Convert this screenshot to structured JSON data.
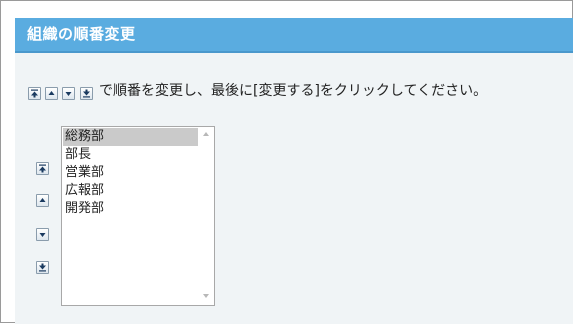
{
  "header": {
    "title": "組織の順番変更"
  },
  "instructions": {
    "text": "で順番を変更し、最後に[変更する]をクリックしてください。"
  },
  "order_buttons": {
    "top_icon": "move-to-top-icon",
    "up_icon": "move-up-icon",
    "down_icon": "move-down-icon",
    "bottom_icon": "move-to-bottom-icon"
  },
  "org_list": {
    "items": [
      {
        "label": "総務部",
        "selected": true
      },
      {
        "label": "部長",
        "selected": false
      },
      {
        "label": "営業部",
        "selected": false
      },
      {
        "label": "広報部",
        "selected": false
      },
      {
        "label": "開発部",
        "selected": false
      }
    ]
  },
  "colors": {
    "header_bg": "#5aace0",
    "panel_bg": "#f0f4f6",
    "selected_bg": "#cacaca"
  }
}
